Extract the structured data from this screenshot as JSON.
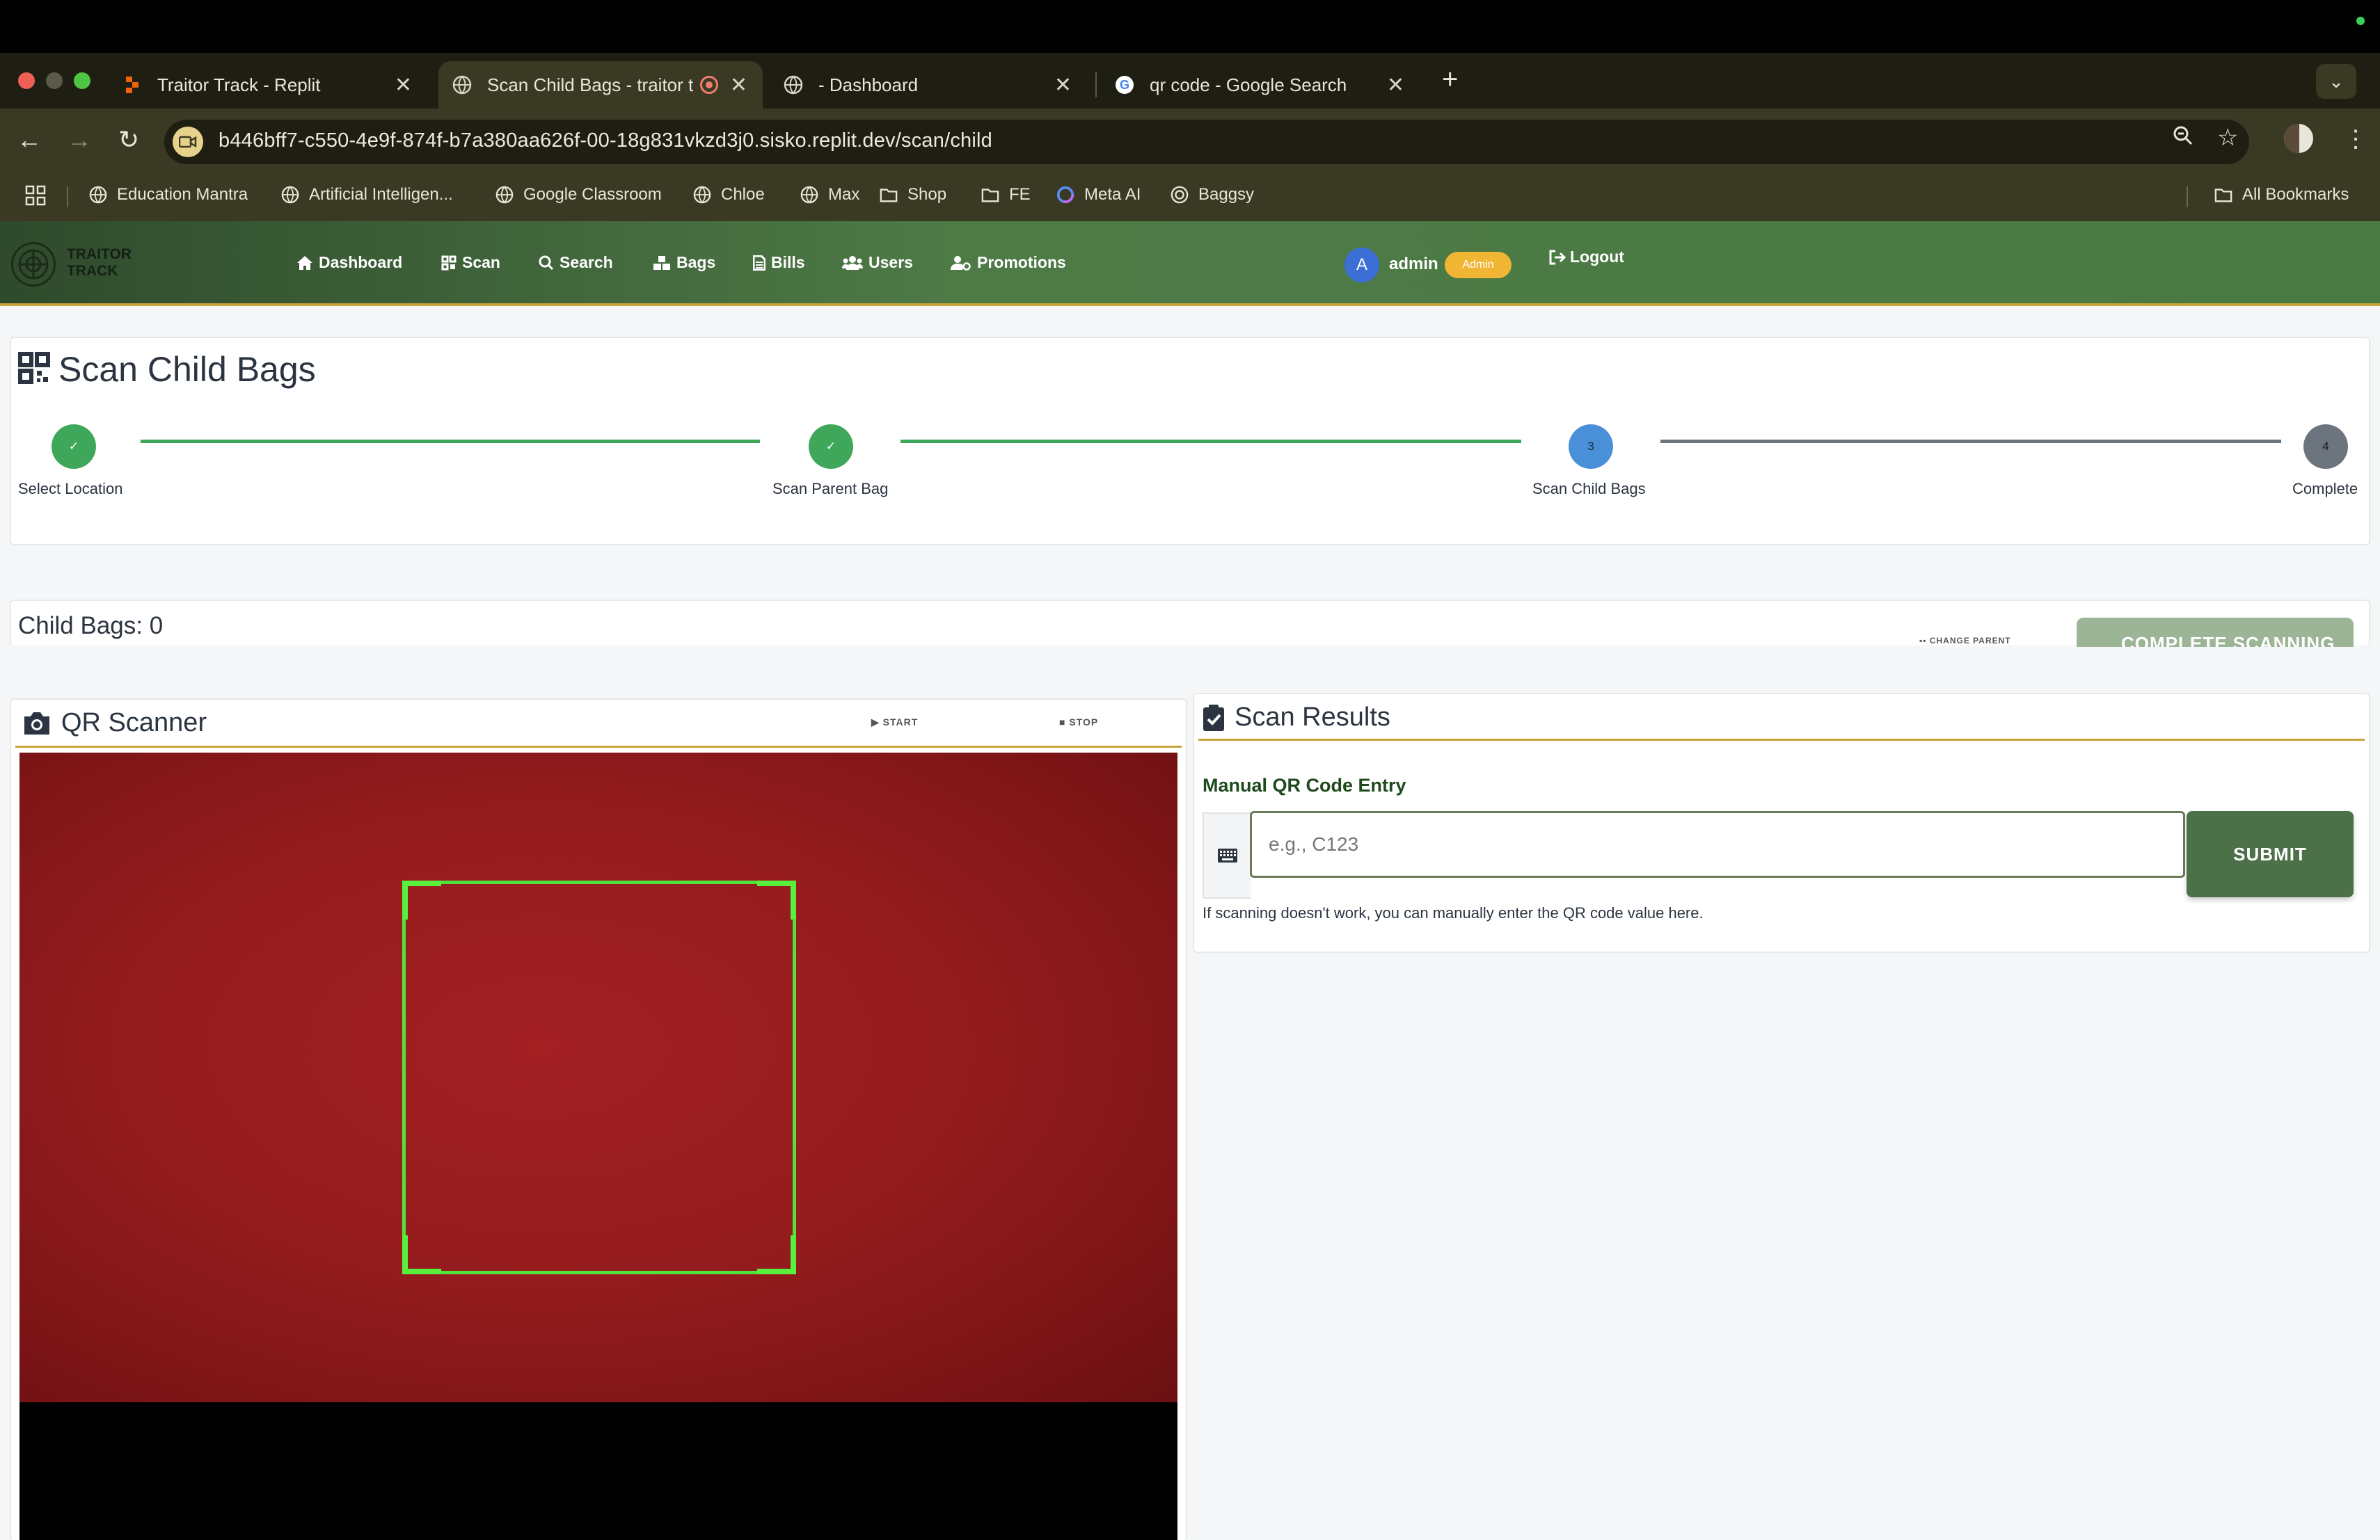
{
  "browser": {
    "tabs": [
      {
        "title": "Traitor Track - Replit",
        "active": false
      },
      {
        "title": "Scan Child Bags - traitor t",
        "active": true
      },
      {
        "title": "- Dashboard",
        "active": false
      },
      {
        "title": "qr code - Google Search",
        "active": false
      }
    ],
    "new_tab": "+",
    "url": "b446bff7-c550-4e9f-874f-b7a380aa626f-00-18g831vkzd3j0.sisko.replit.dev/scan/child",
    "bookmarks": [
      {
        "label": "Education Mantra",
        "icon": "globe-icon"
      },
      {
        "label": "Artificial Intelligen...",
        "icon": "globe-icon"
      },
      {
        "label": "Google Classroom",
        "icon": "globe-icon"
      },
      {
        "label": "Chloe",
        "icon": "globe-icon"
      },
      {
        "label": "Max",
        "icon": "globe-icon"
      },
      {
        "label": "Shop",
        "icon": "folder-icon"
      },
      {
        "label": "FE",
        "icon": "folder-icon"
      },
      {
        "label": "Meta AI",
        "icon": "meta-icon"
      },
      {
        "label": "Baggsy",
        "icon": "openai-icon"
      }
    ],
    "all_bookmarks": "All Bookmarks"
  },
  "app": {
    "logo_text": [
      "TRAITOR",
      "TRACK"
    ],
    "nav": [
      {
        "label": "Dashboard",
        "icon": "home-icon"
      },
      {
        "label": "Scan",
        "icon": "qrcode-icon"
      },
      {
        "label": "Search",
        "icon": "search-icon"
      },
      {
        "label": "Bags",
        "icon": "boxes-icon"
      },
      {
        "label": "Bills",
        "icon": "file-icon"
      },
      {
        "label": "Users",
        "icon": "users-icon"
      },
      {
        "label": "Promotions",
        "icon": "user-cog-icon"
      }
    ],
    "user": {
      "initial": "A",
      "name": "admin",
      "role": "Admin"
    },
    "logout": "Logout",
    "colors": {
      "nav_green": "#4e7a46",
      "accent_gold": "#c8a43a",
      "step_done": "#3fa75a",
      "step_current": "#4a90d9",
      "step_pending": "#6c757d"
    }
  },
  "page": {
    "title": "Scan Child Bags",
    "steps": [
      {
        "label": "Select Location",
        "mark": "✓",
        "status": "done"
      },
      {
        "label": "Scan Parent Bag",
        "mark": "✓",
        "status": "done"
      },
      {
        "label": "Scan Child Bags",
        "mark": "3",
        "status": "current"
      },
      {
        "label": "Complete",
        "mark": "4",
        "status": "pending"
      }
    ],
    "child_bags": "Child Bags: 0",
    "change_parent": "CHANGE PARENT",
    "complete_scanning": "COMPLETE SCANNING",
    "scanner": {
      "title": "QR Scanner",
      "start": "START",
      "stop": "STOP"
    },
    "results": {
      "title": "Scan Results",
      "manual_label": "Manual QR Code Entry",
      "placeholder": "e.g., C123",
      "submit": "SUBMIT",
      "help": "If scanning doesn't work, you can manually enter the QR code value here."
    }
  }
}
